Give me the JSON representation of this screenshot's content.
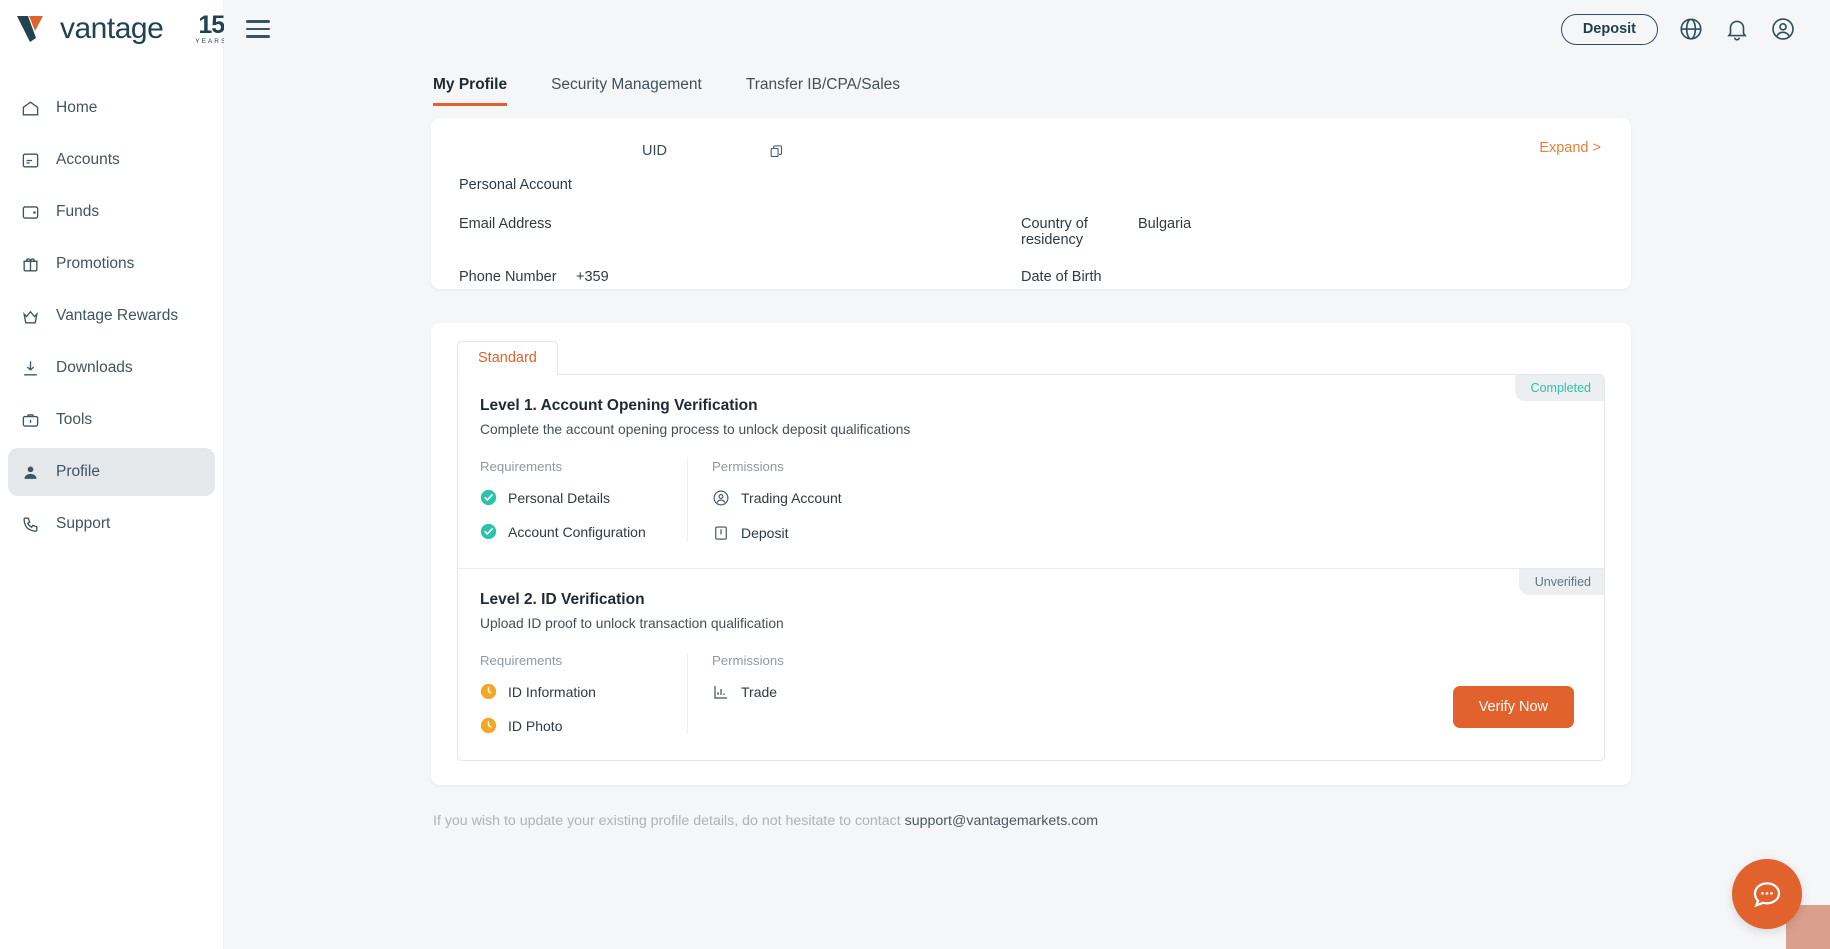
{
  "brand": {
    "name": "vantage",
    "anniversary_number": "15",
    "anniversary_label": "YEARS"
  },
  "sidebar": {
    "items": [
      {
        "label": "Home",
        "icon": "home-icon",
        "active": false
      },
      {
        "label": "Accounts",
        "icon": "accounts-icon",
        "active": false
      },
      {
        "label": "Funds",
        "icon": "wallet-icon",
        "active": false
      },
      {
        "label": "Promotions",
        "icon": "gift-icon",
        "active": false
      },
      {
        "label": "Vantage Rewards",
        "icon": "crown-icon",
        "active": false
      },
      {
        "label": "Downloads",
        "icon": "download-icon",
        "active": false
      },
      {
        "label": "Tools",
        "icon": "toolbox-icon",
        "active": false
      },
      {
        "label": "Profile",
        "icon": "person-icon",
        "active": true
      },
      {
        "label": "Support",
        "icon": "phone-icon",
        "active": false
      }
    ]
  },
  "topbar": {
    "menu_icon": "hamburger-icon",
    "deposit_label": "Deposit",
    "icons": [
      "globe-icon",
      "bell-icon",
      "account-circle-icon"
    ]
  },
  "tabs": [
    {
      "label": "My Profile",
      "active": true
    },
    {
      "label": "Security Management",
      "active": false
    },
    {
      "label": "Transfer IB/CPA/Sales",
      "active": false
    }
  ],
  "profile": {
    "uid_label": "UID",
    "uid_value": "",
    "copy_icon": "copy-icon",
    "expand_label": "Expand >",
    "account_type": "Personal Account",
    "fields": [
      {
        "label": "Email Address",
        "value": ""
      },
      {
        "label": "Country of residency",
        "value": "Bulgaria"
      },
      {
        "label": "Phone Number",
        "value": "+359"
      },
      {
        "label": "Date of Birth",
        "value": ""
      }
    ]
  },
  "verification": {
    "standard_tab": "Standard",
    "requirements_header": "Requirements",
    "permissions_header": "Permissions",
    "levels": [
      {
        "title": "Level 1. Account Opening Verification",
        "description": "Complete the account opening process to unlock deposit qualifications",
        "status": "Completed",
        "status_type": "completed",
        "requirements": [
          {
            "label": "Personal Details",
            "state": "done"
          },
          {
            "label": "Account Configuration",
            "state": "done"
          }
        ],
        "permissions": [
          {
            "label": "Trading Account",
            "icon": "user-circle-icon"
          },
          {
            "label": "Deposit",
            "icon": "deposit-icon"
          }
        ],
        "action": null
      },
      {
        "title": "Level 2. ID Verification",
        "description": "Upload ID proof to unlock transaction qualification",
        "status": "Unverified",
        "status_type": "unverified",
        "requirements": [
          {
            "label": "ID Information",
            "state": "pending"
          },
          {
            "label": "ID Photo",
            "state": "pending"
          }
        ],
        "permissions": [
          {
            "label": "Trade",
            "icon": "chart-icon"
          }
        ],
        "action": "Verify Now"
      }
    ]
  },
  "footer": {
    "text": "If you wish to update your existing profile details, do not hesitate to contact ",
    "email": "support@vantagemarkets.com"
  },
  "chat": {
    "icon": "chat-bubble-icon"
  },
  "colors": {
    "accent_orange": "#e2622e",
    "brand_dark": "#21424f",
    "teal": "#2bc4a8",
    "amber": "#f5a623",
    "page_bg": "#f4f6f8"
  }
}
